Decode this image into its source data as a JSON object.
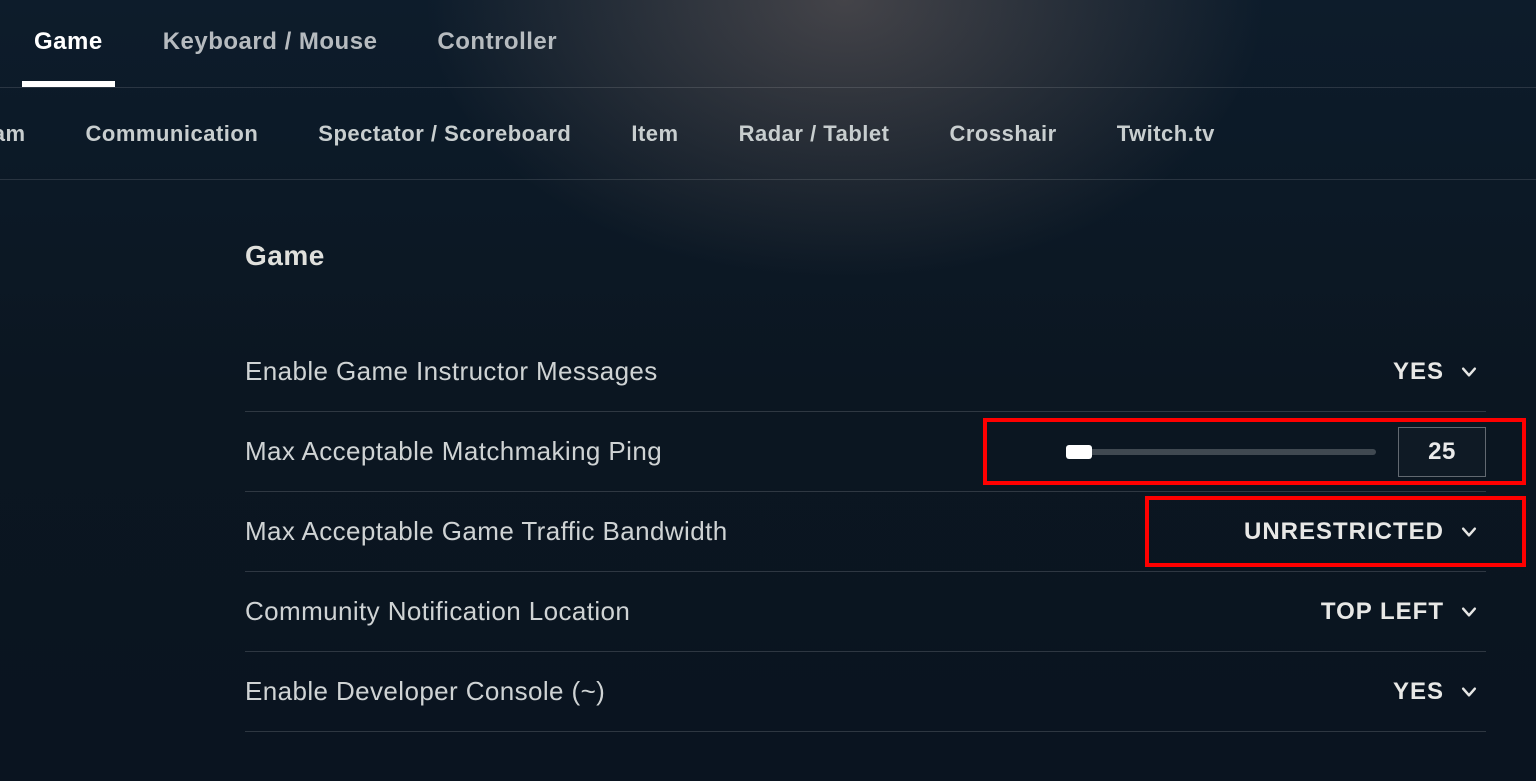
{
  "primaryTabs": {
    "game": "Game",
    "keyboard": "Keyboard / Mouse",
    "controller": "Controller"
  },
  "subTabs": {
    "team": "eam",
    "communication": "Communication",
    "spectator": "Spectator / Scoreboard",
    "item": "Item",
    "radar": "Radar / Tablet",
    "crosshair": "Crosshair",
    "twitch": "Twitch.tv"
  },
  "section": {
    "title": "Game"
  },
  "rows": {
    "instructor": {
      "label": "Enable Game Instructor Messages",
      "value": "YES"
    },
    "ping": {
      "label": "Max Acceptable Matchmaking Ping",
      "value": "25"
    },
    "bandwidth": {
      "label": "Max Acceptable Game Traffic Bandwidth",
      "value": "UNRESTRICTED"
    },
    "notif": {
      "label": "Community Notification Location",
      "value": "TOP LEFT"
    },
    "devcon": {
      "label": "Enable Developer Console (~)",
      "value": "YES"
    }
  }
}
